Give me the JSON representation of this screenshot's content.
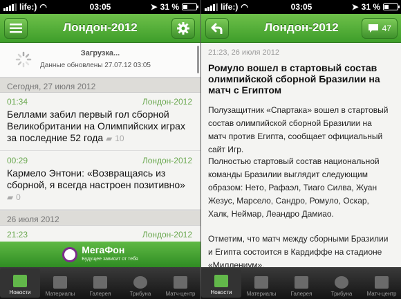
{
  "status": {
    "carrier": "life:)",
    "time": "03:05",
    "battery": "31 %"
  },
  "left": {
    "title": "Лондон-2012",
    "loading_title": "Загрузка...",
    "updated": "Данные обновлены 27.07.12 03:05",
    "sections": [
      {
        "label": "Сегодня, 27 июля 2012"
      },
      {
        "label": "26 июля 2012"
      }
    ],
    "items": [
      {
        "time": "01:34",
        "tag": "Лондон-2012",
        "headline": "Беллами забил первый гол сборной Великобритании на Олимпийских играх за последние 52 года",
        "comments": "10"
      },
      {
        "time": "00:29",
        "tag": "Лондон-2012",
        "headline": "Кармело Энтони: «Возвращаясь из сборной, я всегда настроен позитивно»",
        "comments": "0"
      },
      {
        "time": "21:23",
        "tag": "Лондон-2012"
      }
    ],
    "banner": {
      "brand": "МегаФон",
      "slogan": "Будущее зависит от тебя"
    }
  },
  "right": {
    "title": "Лондон-2012",
    "comments_count": "47",
    "meta": "21:23, 26 июля 2012",
    "headline": "Ромуло вошел в стартовый состав олимпийской сборной Бразилии на матч с Египтом",
    "paragraphs": [
      "Полузащитник «Спартака» вошел в стартовый состав олимпийской сборной Бразилии на матч против Египта, сообщает официальный сайт Игр.",
      "Полностью стартовый состав национальной команды Бразилии выглядит следующим образом: Нето, Рафаэл, Тиаго Силва, Жуан Жезус, Марсело, Сандро, Ромуло, Оскар, Халк, Неймар, Леандро Дамиао.",
      "Отметим, что матч между сборными Бразилии и Египта состоится в Кардиффе на стадионе «Миллениум»."
    ]
  },
  "tabs": [
    {
      "label": "Новости",
      "icon": "news-icon"
    },
    {
      "label": "Материалы",
      "icon": "materials-icon"
    },
    {
      "label": "Галерея",
      "icon": "gallery-icon"
    },
    {
      "label": "Трибуна",
      "icon": "tribune-icon"
    },
    {
      "label": "Матч-центр",
      "icon": "match-center-icon"
    }
  ],
  "colors": {
    "accent": "#4aa832",
    "link": "#6aa84f"
  }
}
